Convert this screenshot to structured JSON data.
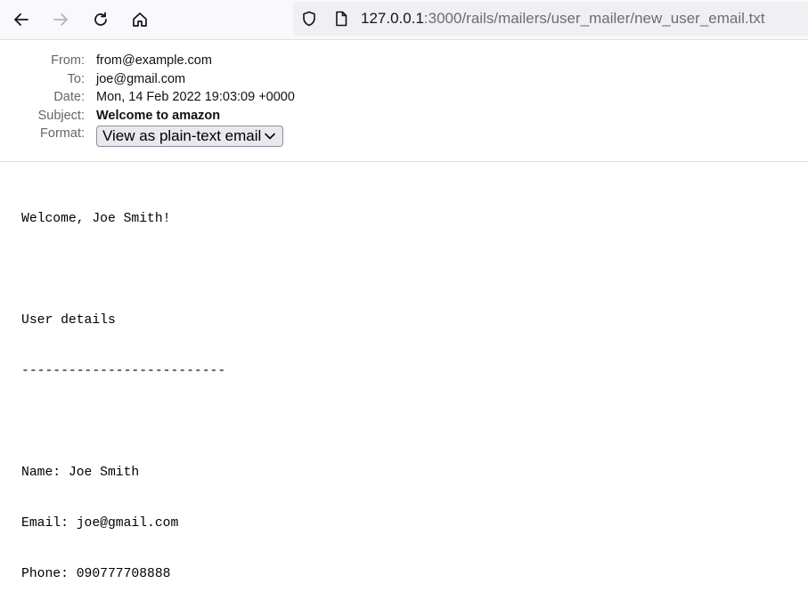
{
  "browser": {
    "url_host": "127.0.0.1",
    "url_path": ":3000/rails/mailers/user_mailer/new_user_email.txt"
  },
  "email": {
    "from_label": "From:",
    "from": "from@example.com",
    "to_label": "To:",
    "to": "joe@gmail.com",
    "date_label": "Date:",
    "date": "Mon, 14 Feb 2022 19:03:09 +0000",
    "subject_label": "Subject:",
    "subject": "Welcome to amazon",
    "format_label": "Format:",
    "format_selected": "View as plain-text email"
  },
  "body": {
    "lines": [
      "Welcome, Joe Smith!",
      "",
      "User details",
      "--------------------------",
      "",
      "Name: Joe Smith",
      "Email: joe@gmail.com",
      "Phone: 090777708888"
    ]
  },
  "icons": {
    "back": "back-arrow-icon",
    "forward": "forward-arrow-icon",
    "reload": "reload-icon",
    "home": "home-icon",
    "shield": "shield-icon",
    "page": "page-icon"
  },
  "colors": {
    "toolbar_bg": "#f9f9fb",
    "urlbar_bg": "#f0f0f4",
    "url_path": "#6c6c75"
  }
}
